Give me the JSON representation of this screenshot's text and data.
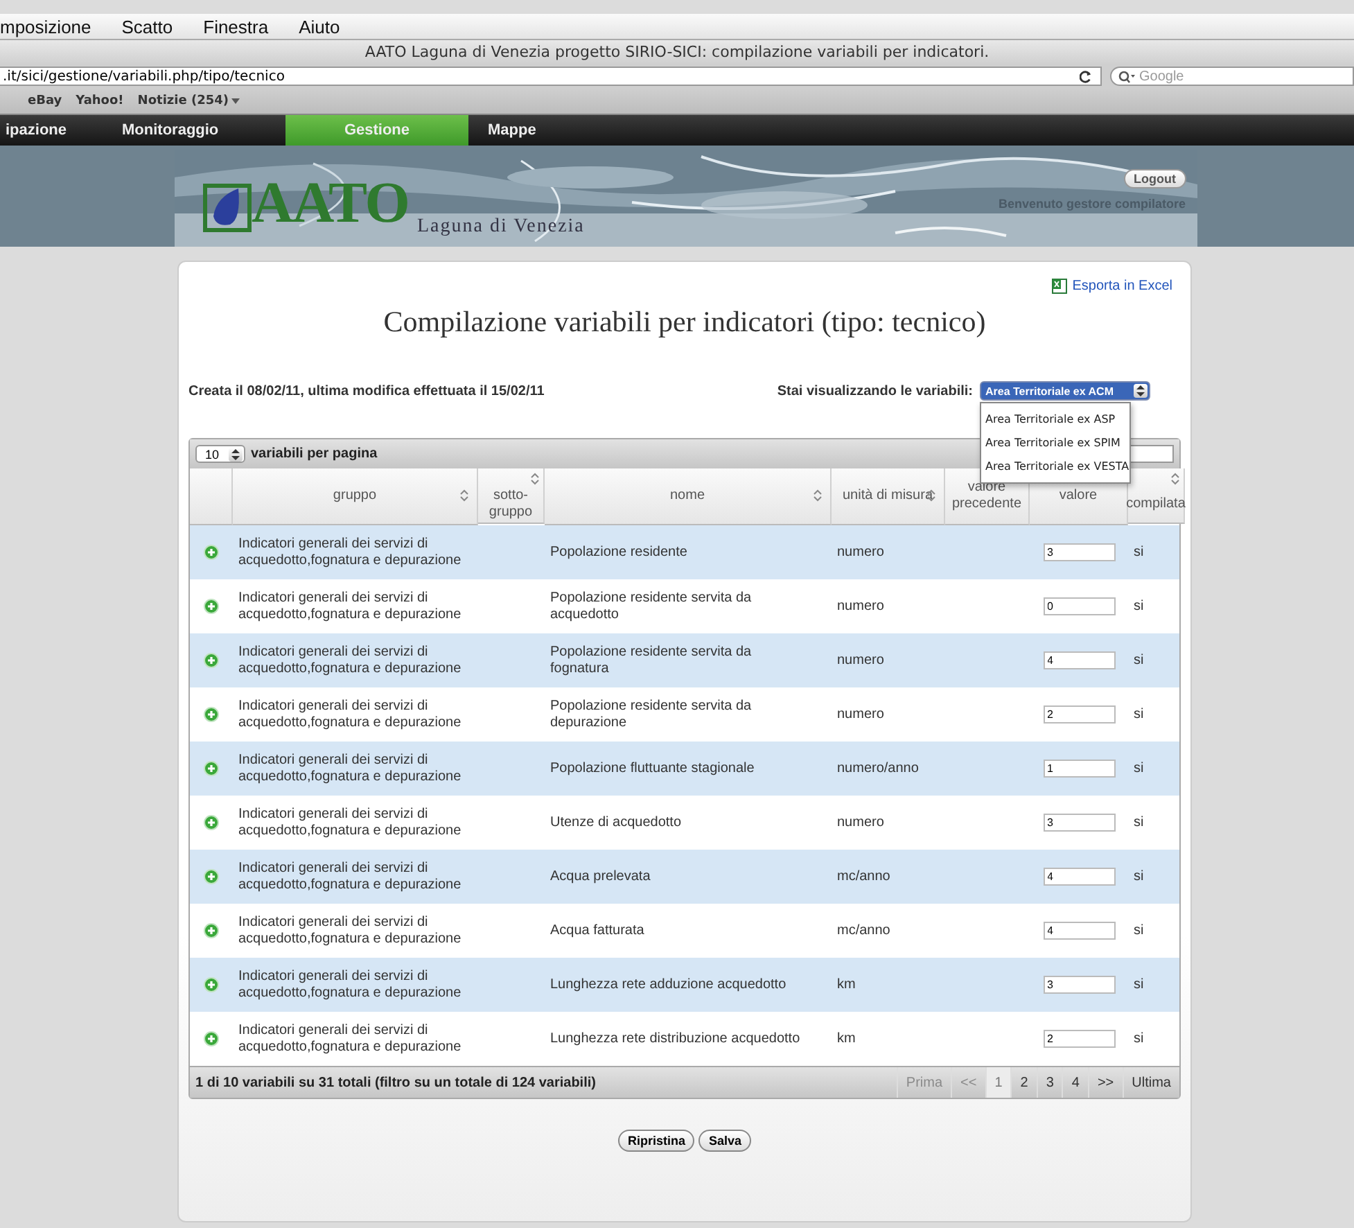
{
  "menu_bar": {
    "items": [
      "mposizione",
      "Scatto",
      "Finestra",
      "Aiuto"
    ]
  },
  "window": {
    "title": "AATO Laguna di Venezia progetto SIRIO-SICI: compilazione variabili per indicatori."
  },
  "address_bar": {
    "url": ".it/sici/gestione/variabili.php/tipo/tecnico",
    "search": {
      "placeholder": "Google"
    }
  },
  "bookmarks": [
    {
      "label": "eBay",
      "menu": false
    },
    {
      "label": "Yahoo!",
      "menu": false
    },
    {
      "label": "Notizie (254)",
      "menu": true
    }
  ],
  "nav": [
    {
      "label": "ipazione",
      "selected": false
    },
    {
      "label": "Monitoraggio",
      "selected": false
    },
    {
      "label": "Gestione",
      "selected": true
    },
    {
      "label": "Mappe",
      "selected": false
    }
  ],
  "banner": {
    "logo": "AATO",
    "subtitle": "Laguna di Venezia",
    "logout": "Logout",
    "welcome": "Benvenuto gestore compilatore"
  },
  "export_link": "Esporta in Excel",
  "page_title": "Compilazione variabili per indicatori (tipo: tecnico)",
  "info": "Creata il 08/02/11, ultima modifica effettuata il 15/02/11",
  "filter": {
    "label": "Stai visualizzando le variabili:",
    "expanded": true,
    "options": [
      {
        "label": "Area Territoriale ex ACM",
        "selected": true
      },
      {
        "label": "Area Territoriale ex ASP",
        "selected": false
      },
      {
        "label": "Area Territoriale ex SPIM",
        "selected": false
      },
      {
        "label": "Area Territoriale ex VESTA",
        "selected": false
      }
    ]
  },
  "page_size": {
    "value": "10",
    "label": "variabili per pagina"
  },
  "table": {
    "columns": [
      {
        "sortable": false
      },
      {
        "label": "gruppo",
        "sortable": true
      },
      {
        "label": "sotto-gruppo",
        "sortable": true
      },
      {
        "label": "nome",
        "sortable": true
      },
      {
        "label": "unità di misura",
        "sortable": true
      },
      {
        "label": "valore precedente",
        "sortable": false
      },
      {
        "label": "valore",
        "sortable": false
      },
      {
        "label": "compilata",
        "sortable": true
      }
    ],
    "rows": [
      {
        "gruppo": "Indicatori generali dei servizi di acquedotto,fognatura e depurazione",
        "nome": "Popolazione residente",
        "unita": "numero",
        "valore": "3",
        "compilata": "si"
      },
      {
        "gruppo": "Indicatori generali dei servizi di acquedotto,fognatura e depurazione",
        "nome": "Popolazione residente servita da acquedotto",
        "unita": "numero",
        "valore": "0",
        "compilata": "si"
      },
      {
        "gruppo": "Indicatori generali dei servizi di acquedotto,fognatura e depurazione",
        "nome": "Popolazione residente servita da fognatura",
        "unita": "numero",
        "valore": "4",
        "compilata": "si"
      },
      {
        "gruppo": "Indicatori generali dei servizi di acquedotto,fognatura e depurazione",
        "nome": "Popolazione residente servita da depurazione",
        "unita": "numero",
        "valore": "2",
        "compilata": "si"
      },
      {
        "gruppo": "Indicatori generali dei servizi di acquedotto,fognatura e depurazione",
        "nome": "Popolazione fluttuante stagionale",
        "unita": "numero/anno",
        "valore": "1",
        "compilata": "si"
      },
      {
        "gruppo": "Indicatori generali dei servizi di acquedotto,fognatura e depurazione",
        "nome": "Utenze di acquedotto",
        "unita": "numero",
        "valore": "3",
        "compilata": "si"
      },
      {
        "gruppo": "Indicatori generali dei servizi di acquedotto,fognatura e depurazione",
        "nome": "Acqua prelevata",
        "unita": "mc/anno",
        "valore": "4",
        "compilata": "si"
      },
      {
        "gruppo": "Indicatori generali dei servizi di acquedotto,fognatura e depurazione",
        "nome": "Acqua fatturata",
        "unita": "mc/anno",
        "valore": "4",
        "compilata": "si"
      },
      {
        "gruppo": "Indicatori generali dei servizi di acquedotto,fognatura e depurazione",
        "nome": "Lunghezza rete adduzione acquedotto",
        "unita": "km",
        "valore": "3",
        "compilata": "si"
      },
      {
        "gruppo": "Indicatori generali dei servizi di acquedotto,fognatura e depurazione",
        "nome": "Lunghezza rete distribuzione acquedotto",
        "unita": "km",
        "valore": "2",
        "compilata": "si"
      }
    ]
  },
  "summary": "1 di 10 variabili su 31 totali (filtro su un totale di 124 variabili)",
  "pagination": [
    {
      "label": "Prima",
      "disabled": true,
      "selected": false
    },
    {
      "label": "<<",
      "disabled": true,
      "selected": false
    },
    {
      "label": "1",
      "disabled": false,
      "selected": true
    },
    {
      "label": "2",
      "disabled": false,
      "selected": false
    },
    {
      "label": "3",
      "disabled": false,
      "selected": false
    },
    {
      "label": "4",
      "disabled": false,
      "selected": false
    },
    {
      "label": ">>",
      "disabled": false,
      "selected": false
    },
    {
      "label": "Ultima",
      "disabled": false,
      "selected": false
    }
  ],
  "buttons": [
    "Ripristina",
    "Salva"
  ]
}
